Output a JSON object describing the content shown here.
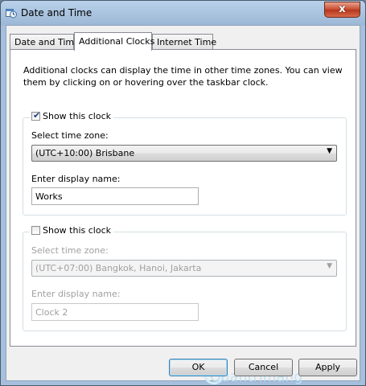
{
  "window": {
    "title": "Date and Time",
    "close_glyph": "x",
    "icon": "date-time-icon"
  },
  "tabs": [
    {
      "label": "Date and Time"
    },
    {
      "label": "Additional Clocks"
    },
    {
      "label": "Internet Time"
    }
  ],
  "panel": {
    "description": "Additional clocks can display the time in other time zones. You can view them by clicking on or hovering over the taskbar clock."
  },
  "clock1": {
    "show_label": "Show this clock",
    "checked": true,
    "timezone_label": "Select time zone:",
    "timezone_value": "(UTC+10:00) Brisbane",
    "name_label": "Enter display name:",
    "name_value": "Works"
  },
  "clock2": {
    "show_label": "Show this clock",
    "checked": false,
    "timezone_label": "Select time zone:",
    "timezone_value": "(UTC+07:00) Bangkok, Hanoi, Jakarta",
    "name_label": "Enter display name:",
    "name_value": "Clock 2"
  },
  "buttons": {
    "ok": "OK",
    "cancel": "Cancel",
    "apply": "Apply"
  },
  "watermark": "Quantrimang",
  "glyphs": {
    "check": "✔",
    "dropdown_arrow": "▼"
  }
}
